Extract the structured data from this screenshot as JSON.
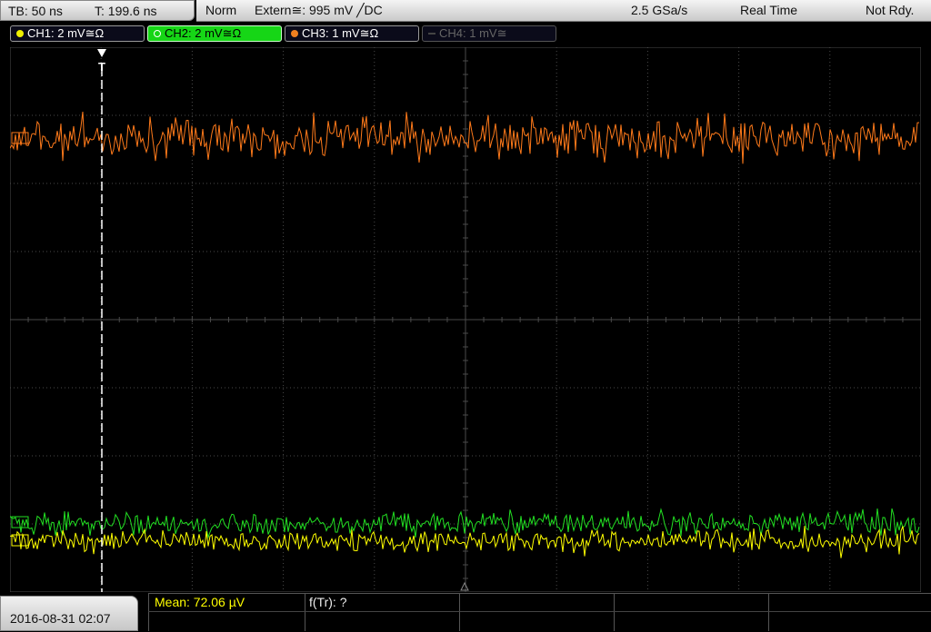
{
  "top_left": {
    "timebase": "TB: 50 ns",
    "trigger_time": "T: 199.6 ns"
  },
  "status_bar": {
    "mode": "Norm",
    "trigger": "Extern≅: 995 mV ╱DC",
    "sample_rate": "2.5 GSa/s",
    "acq_mode": "Real Time",
    "state": "Not Rdy."
  },
  "channels": [
    {
      "label": "CH1: 2 mV≅Ω",
      "color": "#f0f000",
      "state": "on"
    },
    {
      "label": "CH2: 2 mV≅Ω",
      "color": "#16d616",
      "state": "active"
    },
    {
      "label": "CH3: 1 mV≅Ω",
      "color": "#f08020",
      "state": "on"
    },
    {
      "label": "CH4: 1 mV≅",
      "color": "#666666",
      "state": "off"
    }
  ],
  "waveform_colors": {
    "ch1": "#ffff00",
    "ch2": "#22e022",
    "ch3": "#ff7a1a",
    "grid": "#4a4a4a"
  },
  "measurements": {
    "mean": "Mean: 72.06 µV",
    "frequency": "f(Tr): ?"
  },
  "datetime": "2016-08-31 02:07",
  "trigger_marker": "T"
}
